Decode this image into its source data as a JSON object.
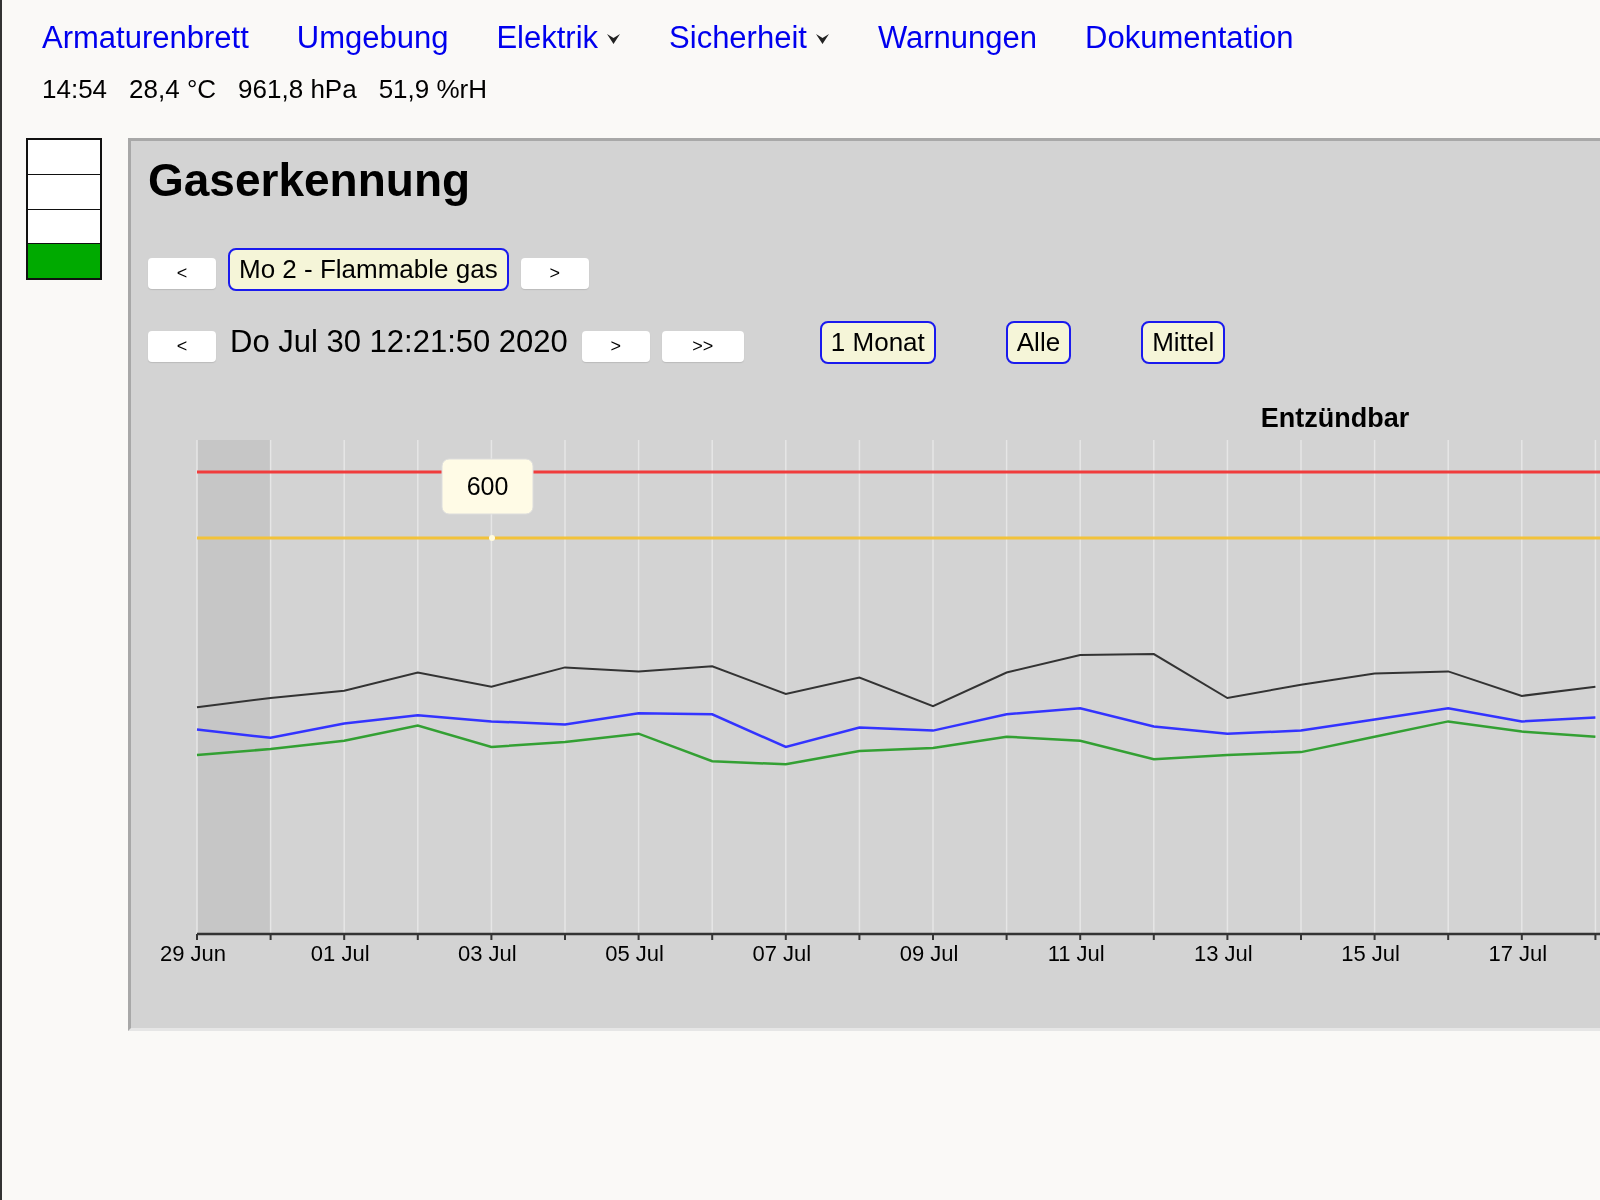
{
  "nav": [
    {
      "label": "Armaturenbrett",
      "dropdown": false
    },
    {
      "label": "Umgebung",
      "dropdown": false
    },
    {
      "label": "Elektrik",
      "dropdown": true
    },
    {
      "label": "Sicherheit",
      "dropdown": true
    },
    {
      "label": "Warnungen",
      "dropdown": false
    },
    {
      "label": "Dokumentation",
      "dropdown": false
    }
  ],
  "status": [
    "14:54",
    "28,4 °C",
    "961,8 hPa",
    "51,9 %rH"
  ],
  "level_indicator": [
    {
      "on": false
    },
    {
      "on": false
    },
    {
      "on": false
    },
    {
      "on": true
    }
  ],
  "panel": {
    "title": "Gaserkennung",
    "sensor_nav": {
      "prev": "<",
      "sensor": "Mo 2 - Flammable gas",
      "next": ">"
    },
    "date_nav": {
      "prev": "<",
      "date": "Do Jul 30 12:21:50 2020",
      "next": ">",
      "last": ">>"
    },
    "range_buttons": [
      "1 Monat",
      "Alle",
      "Mittel"
    ],
    "chart": {
      "title": "Entzündbar",
      "tooltip": "600",
      "x_labels": [
        "29 Jun",
        "01 Jul",
        "03 Jul",
        "05 Jul",
        "07 Jul",
        "09 Jul",
        "11 Jul",
        "13 Jul",
        "15 Jul",
        "17 Jul"
      ]
    }
  }
}
